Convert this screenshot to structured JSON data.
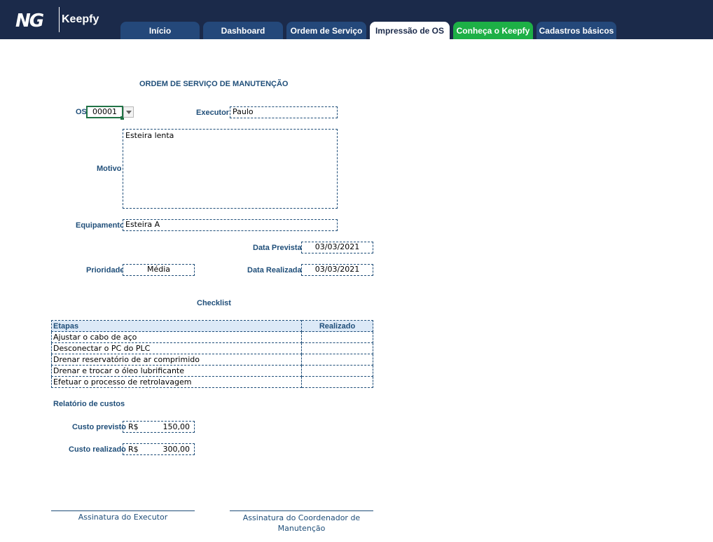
{
  "header": {
    "logo_mark": "NG",
    "brand": "Keepfy",
    "tabs": [
      {
        "label": "Início"
      },
      {
        "label": "Dashboard"
      },
      {
        "label": "Ordem de Serviço"
      },
      {
        "label": "Impressão de OS"
      },
      {
        "label": "Conheça o Keepfy"
      },
      {
        "label": "Cadastros básicos"
      }
    ]
  },
  "form": {
    "title": "ORDEM DE SERVIÇO DE MANUTENÇÃO",
    "os_label": "OS",
    "os_value": "00001",
    "executor_label": "Executor",
    "executor_value": "Paulo",
    "motivo_label": "Motivo",
    "motivo_value": "Esteira lenta",
    "equipamento_label": "Equipamento",
    "equipamento_value": "Esteira A",
    "data_prevista_label": "Data Prevista",
    "data_prevista_value": "03/03/2021",
    "prioridade_label": "Prioridade",
    "prioridade_value": "Média",
    "data_realizada_label": "Data Realizada",
    "data_realizada_value": "03/03/2021"
  },
  "checklist": {
    "title": "Checklist",
    "headers": [
      "Etapas",
      "Realizado"
    ],
    "rows": [
      {
        "etapa": "Ajustar o cabo de aço",
        "realizado": ""
      },
      {
        "etapa": "Desconectar o PC do PLC",
        "realizado": ""
      },
      {
        "etapa": "Drenar reservatório de ar comprimido",
        "realizado": ""
      },
      {
        "etapa": "Drenar e trocar o óleo lubrificante",
        "realizado": ""
      },
      {
        "etapa": "Efetuar o processo de retrolavagem",
        "realizado": ""
      }
    ]
  },
  "costs": {
    "title": "Relatório de custos",
    "previsto_label": "Custo previsto",
    "previsto_currency": "R$",
    "previsto_value": "150,00",
    "realizado_label": "Custo realizado",
    "realizado_currency": "R$",
    "realizado_value": "300,00"
  },
  "signatures": {
    "executor": "Assinatura do Executor",
    "coordenador": "Assinatura do Coordenador de Manutenção"
  },
  "colors": {
    "topbar": "#1b2a4a",
    "tab": "#24487a",
    "tab_green": "#1db046",
    "label": "#1f4e79"
  }
}
